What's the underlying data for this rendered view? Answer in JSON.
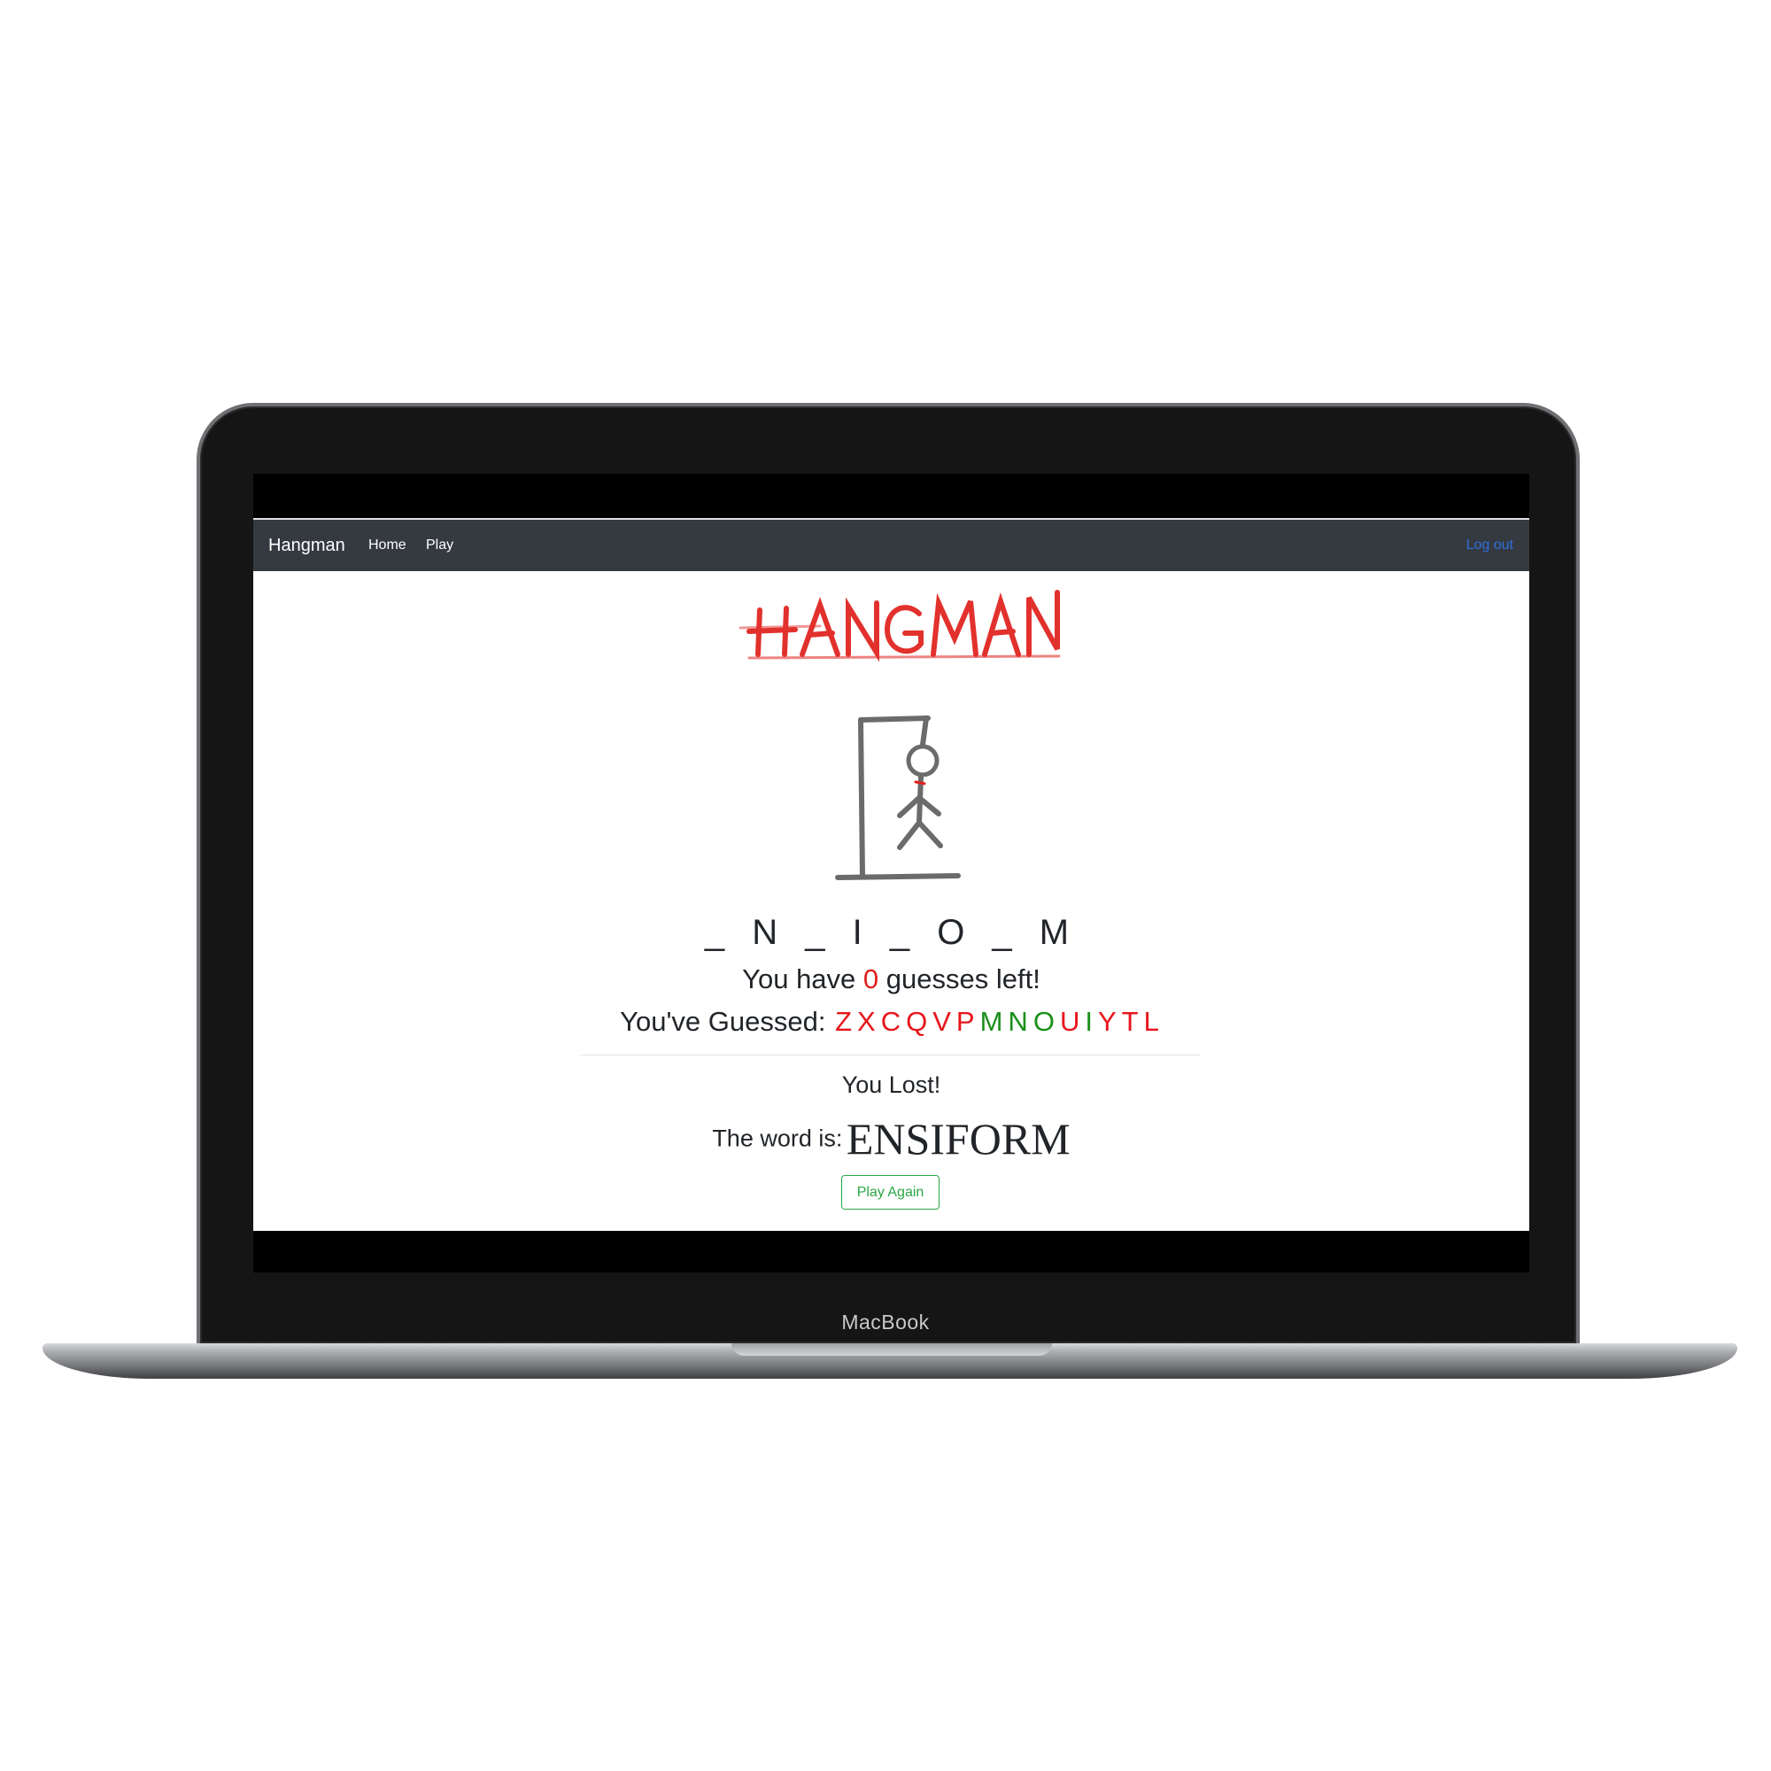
{
  "device": {
    "label": "MacBook"
  },
  "navbar": {
    "brand": "Hangman",
    "links": [
      "Home",
      "Play"
    ],
    "logout": "Log out",
    "logout_color": "#2f6fe0",
    "background": "#343a40"
  },
  "logo": {
    "text": "HANGMAN",
    "color": "#e0201c"
  },
  "game": {
    "masked_word": "_N_I_O_M",
    "guesses_left_prefix": "You have",
    "guesses_left_count": "0",
    "guesses_left_suffix": "guesses left!",
    "guessed_label": "You've Guessed:",
    "guessed_letters": [
      {
        "letter": "Z",
        "correct": false
      },
      {
        "letter": "X",
        "correct": false
      },
      {
        "letter": "C",
        "correct": false
      },
      {
        "letter": "Q",
        "correct": false
      },
      {
        "letter": "V",
        "correct": false
      },
      {
        "letter": "P",
        "correct": false
      },
      {
        "letter": "M",
        "correct": true
      },
      {
        "letter": "N",
        "correct": true
      },
      {
        "letter": "O",
        "correct": true
      },
      {
        "letter": "U",
        "correct": false
      },
      {
        "letter": "I",
        "correct": true
      },
      {
        "letter": "Y",
        "correct": false
      },
      {
        "letter": "T",
        "correct": false
      },
      {
        "letter": "L",
        "correct": false
      }
    ],
    "wrong_color": "#e8141b",
    "correct_color": "#1a8f1a",
    "result": "You Lost!",
    "word_label": "The word is:",
    "word": "ENSIFORM",
    "play_again": "Play Again"
  }
}
